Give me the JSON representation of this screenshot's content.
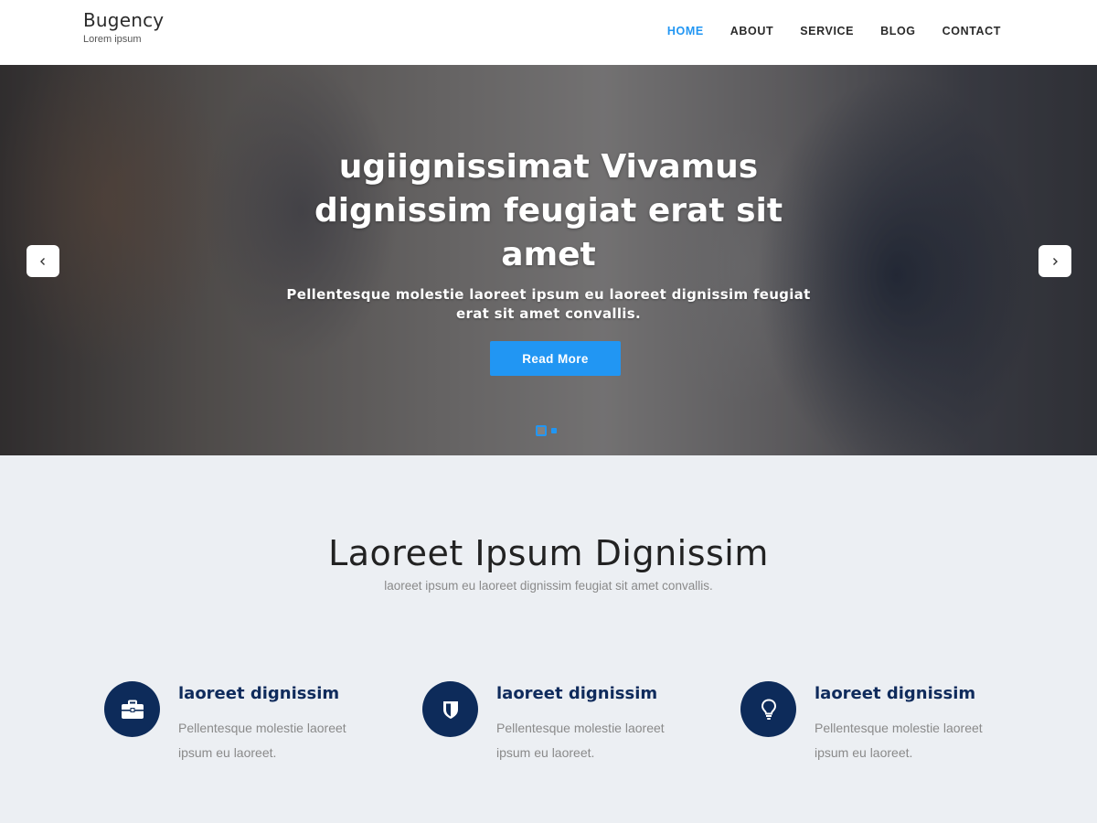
{
  "header": {
    "brand_name": "Bugency",
    "brand_tagline": "Lorem ipsum",
    "nav": [
      {
        "label": "HOME",
        "active": true
      },
      {
        "label": "ABOUT",
        "active": false
      },
      {
        "label": "SERVICE",
        "active": false
      },
      {
        "label": "BLOG",
        "active": false
      },
      {
        "label": "CONTACT",
        "active": false
      }
    ]
  },
  "hero": {
    "title": "ugiignissimat Vivamus dignissim feugiat erat sit amet",
    "subtitle": "Pellentesque molestie laoreet ipsum eu laoreet dignissim feugiat erat sit amet convallis.",
    "button_label": "Read More",
    "prev_icon": "chevron-left-icon",
    "next_icon": "chevron-right-icon",
    "slides_total": 2,
    "active_slide": 1
  },
  "section": {
    "title": "Laoreet Ipsum Dignissim",
    "subtitle": "laoreet ipsum eu laoreet dignissim feugiat sit amet convallis."
  },
  "features": [
    {
      "icon": "briefcase-icon",
      "title": "laoreet dignissim",
      "text": "Pellentesque molestie laoreet ipsum eu laoreet."
    },
    {
      "icon": "shield-icon",
      "title": "laoreet dignissim",
      "text": "Pellentesque molestie laoreet ipsum eu laoreet."
    },
    {
      "icon": "lightbulb-icon",
      "title": "laoreet dignissim",
      "text": "Pellentesque molestie laoreet ipsum eu laoreet."
    }
  ],
  "colors": {
    "accent": "#2196f3",
    "navy": "#0d2b5a",
    "section_bg": "#eceff3"
  }
}
